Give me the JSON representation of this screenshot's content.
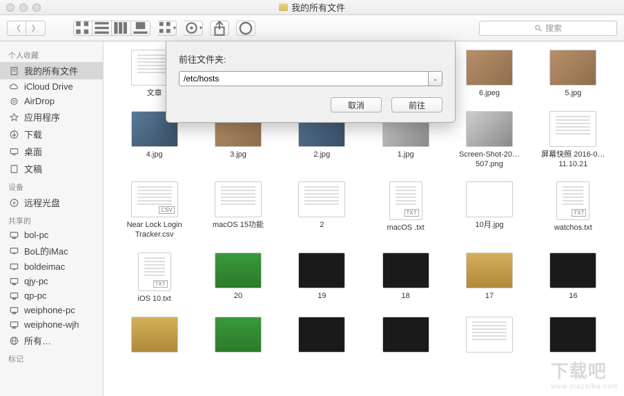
{
  "window": {
    "title": "我的所有文件"
  },
  "toolbar": {
    "search_placeholder": "搜索"
  },
  "sidebar": {
    "sections": [
      {
        "header": "个人收藏",
        "items": [
          {
            "label": "我的所有文件",
            "icon": "doc",
            "selected": true
          },
          {
            "label": "iCloud Drive",
            "icon": "cloud"
          },
          {
            "label": "AirDrop",
            "icon": "airdrop"
          },
          {
            "label": "应用程序",
            "icon": "apps"
          },
          {
            "label": "下载",
            "icon": "download"
          },
          {
            "label": "桌面",
            "icon": "desktop"
          },
          {
            "label": "文稿",
            "icon": "docs"
          }
        ]
      },
      {
        "header": "设备",
        "items": [
          {
            "label": "远程光盘",
            "icon": "disc"
          }
        ]
      },
      {
        "header": "共享的",
        "items": [
          {
            "label": "bol-pc",
            "icon": "pc"
          },
          {
            "label": "BoL的iMac",
            "icon": "imac"
          },
          {
            "label": "boldeimac",
            "icon": "imac"
          },
          {
            "label": "qjy-pc",
            "icon": "pc"
          },
          {
            "label": "qp-pc",
            "icon": "pc"
          },
          {
            "label": "weiphone-pc",
            "icon": "pc"
          },
          {
            "label": "weiphone-wjh",
            "icon": "pc"
          },
          {
            "label": "所有…",
            "icon": "globe"
          }
        ]
      },
      {
        "header": "标记",
        "items": []
      }
    ]
  },
  "files": [
    {
      "name": "文章",
      "kind": "doc"
    },
    {
      "name": "",
      "kind": "hidden_by_dialog"
    },
    {
      "name": "",
      "kind": "hidden_by_dialog"
    },
    {
      "name": "",
      "kind": "hidden_by_dialog"
    },
    {
      "name": "6.jpeg",
      "kind": "photo"
    },
    {
      "name": "5.jpg",
      "kind": "photo"
    },
    {
      "name": "4.jpg",
      "kind": "photo2"
    },
    {
      "name": "3.jpg",
      "kind": "photo"
    },
    {
      "name": "2.jpg",
      "kind": "photo2"
    },
    {
      "name": "1.jpg",
      "kind": "photo3"
    },
    {
      "name": "Screen-Shot-20…507.png",
      "kind": "photo3"
    },
    {
      "name": "屏幕快照 2016-0…11.10.21",
      "kind": "doc"
    },
    {
      "name": "Near Lock Login Tracker.csv",
      "kind": "csv"
    },
    {
      "name": "macOS 15功能",
      "kind": "doc"
    },
    {
      "name": "2",
      "kind": "doc"
    },
    {
      "name": "macOS .txt",
      "kind": "txt"
    },
    {
      "name": "10月.jpg",
      "kind": "cal"
    },
    {
      "name": "watchos.txt",
      "kind": "txt"
    },
    {
      "name": "iOS 10.txt",
      "kind": "txt"
    },
    {
      "name": "20",
      "kind": "green"
    },
    {
      "name": "19",
      "kind": "dark"
    },
    {
      "name": "18",
      "kind": "dark"
    },
    {
      "name": "17",
      "kind": "watch"
    },
    {
      "name": "16",
      "kind": "dark"
    },
    {
      "name": "",
      "kind": "watch"
    },
    {
      "name": "",
      "kind": "green"
    },
    {
      "name": "",
      "kind": "dark"
    },
    {
      "name": "",
      "kind": "dark"
    },
    {
      "name": "",
      "kind": "doc"
    },
    {
      "name": "",
      "kind": "dark"
    }
  ],
  "dialog": {
    "label": "前往文件夹:",
    "value": "/etc/hosts",
    "cancel": "取消",
    "go": "前往"
  },
  "watermark": {
    "main": "下载吧",
    "sub": "www.xiazaiba.com"
  }
}
